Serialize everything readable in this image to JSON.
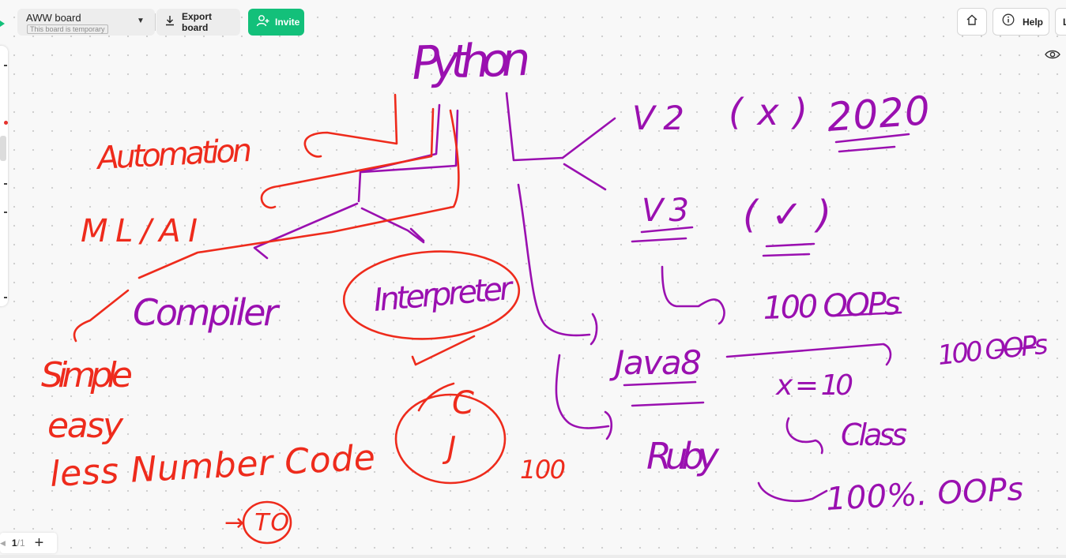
{
  "board": {
    "name": "AWW board",
    "status": "This board is temporary",
    "export_label": "Export board",
    "invite_label": "Invite"
  },
  "header_right": {
    "help_label": "Help",
    "cutoff_label": "L"
  },
  "pager": {
    "current": "1",
    "total": "/1"
  },
  "colors": {
    "accent_green": "#13c07a",
    "ink_red": "#ee2b1c",
    "ink_purple": "#9a10b0"
  },
  "handwriting": {
    "python": "Python",
    "automation": "Automation",
    "ml_ai": "ML/AI",
    "compiler": "Compiler",
    "interpreter": "Interpreter",
    "simple": "Simple",
    "easy": "easy",
    "less_number_code": "less Number Code",
    "to": "→ TO",
    "circle_c": "C",
    "circle_j": "J",
    "hundred": "100",
    "v2": "V2",
    "x_mark": "(x)",
    "year": "2020",
    "v3": "V3",
    "check": "(✓)",
    "hundred_oops": "100 OOPs",
    "java8": "Java8",
    "x_eq": "x = 10",
    "class": "Class",
    "ruby": "Ruby",
    "hundred_oops_right": "100 OOPs",
    "hundred_oops_bottom": "100%. OOPs"
  }
}
